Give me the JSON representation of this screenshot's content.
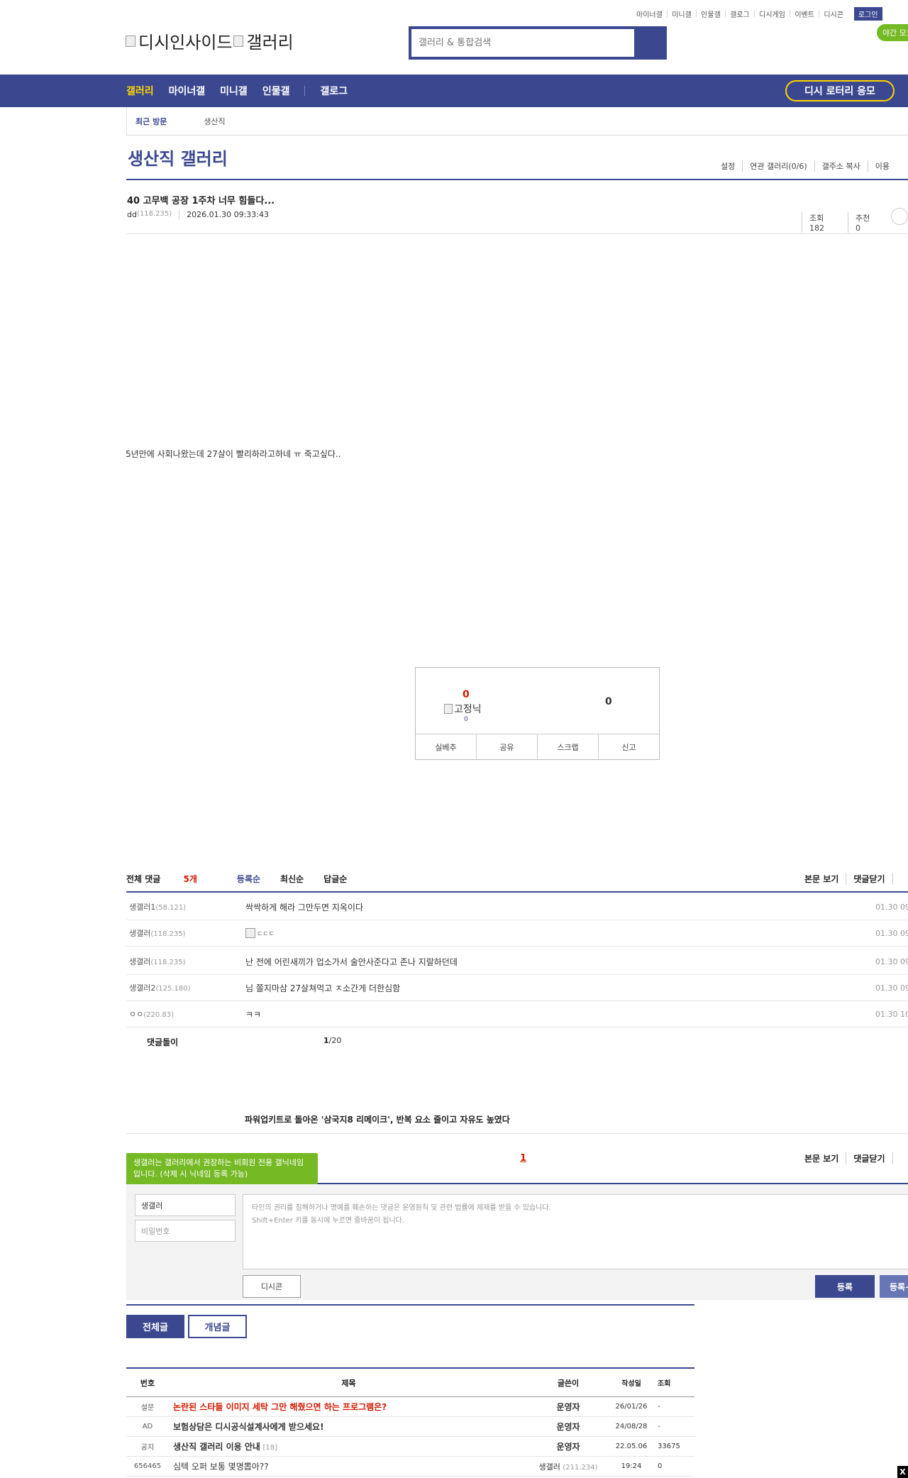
{
  "util_nav": {
    "items": [
      "마이너갤",
      "미니갤",
      "인물갤",
      "갤로그",
      "디시게임",
      "이벤트",
      "디시콘"
    ],
    "login": "로그인",
    "night_mode": "야간 모드"
  },
  "logo": {
    "alt1": "디시인사이드",
    "alt2": "갤러리"
  },
  "search": {
    "placeholder": "갤러리 & 통합검색"
  },
  "gnb": {
    "items": [
      "갤러리",
      "마이너갤",
      "미니갤",
      "인물갤",
      "갤로그"
    ],
    "lottery": "디시 로터리 응모"
  },
  "recent": {
    "label": "최근 방문",
    "item": "생산직"
  },
  "gallery": {
    "title": "생산직 갤러리",
    "menu": [
      "설정",
      "연관 갤러리(0/6)",
      "갤주소 복사",
      "이용"
    ]
  },
  "post": {
    "title": "40 고무백 공장 1주차 너무 힘들다...",
    "author": "dd",
    "ip": "(118.235)",
    "datetime": "2026.01.30 09:33:43",
    "views": "조회 182",
    "recommend": "추천 0",
    "body": "5년만에 사회나왔는데 27살이 빨리하라고하네 ㅠ 죽고싶다.."
  },
  "recommend_box": {
    "up": "0",
    "fixed_alt": "고정닉",
    "up_fixed": "0",
    "down": "0",
    "actions": [
      "실베추",
      "공유",
      "스크랩",
      "신고"
    ]
  },
  "comments": {
    "header_label": "전체 댓글",
    "count": "5개",
    "sorts": [
      "등록순",
      "최신순",
      "답글순"
    ],
    "right": [
      "본문 보기",
      "댓글닫기"
    ],
    "items": [
      {
        "nick": "생갤러1",
        "ip": "(58.121)",
        "text": "싹싹하게 해라 그만두면 지옥이다",
        "time": "01.30 09"
      },
      {
        "nick": "생갤러",
        "ip": "(118.235)",
        "text": "",
        "alt": "ㄷㄷㄷ",
        "time": "01.30 09"
      },
      {
        "nick": "생갤러",
        "ip": "(118.235)",
        "text": "난 전에 어린새끼가 업소가서 술안사준다고 존나 지랄하던데",
        "time": "01.30 09"
      },
      {
        "nick": "생갤러2",
        "ip": "(125.180)",
        "text": "님 쫄지마삼 27살쳐먹고 ㅈ소간게 더한심함",
        "time": "01.30 09"
      },
      {
        "nick": "ㅇㅇ",
        "ip": "(220.83)",
        "text": "ㅋㅋ",
        "time": "01.30 10"
      }
    ],
    "footer_label": "댓글돌이",
    "page_current": "1",
    "page_total": "/20",
    "page_link": "1"
  },
  "news": {
    "title": "파워업키트로 돌아온 '삼국지8 리메이크', 반복 요소 줄이고 자유도 높였다"
  },
  "write": {
    "tip": "생갤러는 갤러리에서 권장하는 비회원 전용 갤닉네임입니다. (삭제 시 닉네임 등록 가능)",
    "nick_value": "생갤러",
    "password_placeholder": "비밀번호",
    "textarea_line1": "타인의 권리를 침해하거나 명예를 훼손하는 댓글은 운영원칙 및 관련 법률에 제재를 받을 수 있습니다.",
    "textarea_line2": "Shift+Enter 키를 동시에 누르면 줄바꿈이 됩니다.",
    "dccon": "디시콘",
    "submit": "등록",
    "submit2": "등록+추천"
  },
  "list_tabs": {
    "all": "전체글",
    "concept": "개념글"
  },
  "list": {
    "headers": {
      "no": "번호",
      "subject": "제목",
      "writer": "글쓴이",
      "date": "작성일",
      "views": "조회"
    },
    "rows": [
      {
        "no": "설문",
        "subject": "논란된 스타들 이미지 세탁 그만 해줬으면 하는 프로그램은?",
        "comments": "",
        "writer": "운영자",
        "writer_ip": "",
        "date": "26/01/26",
        "views": "-",
        "style": "red"
      },
      {
        "no": "AD",
        "subject": "보험상담은 디시공식설계사에게 받으세요!",
        "comments": "",
        "writer": "운영자",
        "writer_ip": "",
        "date": "24/08/28",
        "views": "-",
        "style": "bold"
      },
      {
        "no": "공지",
        "subject": "생산직 갤러리 이용 안내",
        "comments": "[18]",
        "writer": "운영자",
        "writer_ip": "",
        "date": "22.05.06",
        "views": "33675",
        "style": "bold"
      },
      {
        "no": "656465",
        "subject": "심텍 오퍼 보통 몇명뽑아??",
        "comments": "",
        "writer": "생갤러",
        "writer_ip": "(211.234)",
        "date": "19:24",
        "views": "0",
        "style": "norm"
      }
    ]
  },
  "close_button": "X"
}
